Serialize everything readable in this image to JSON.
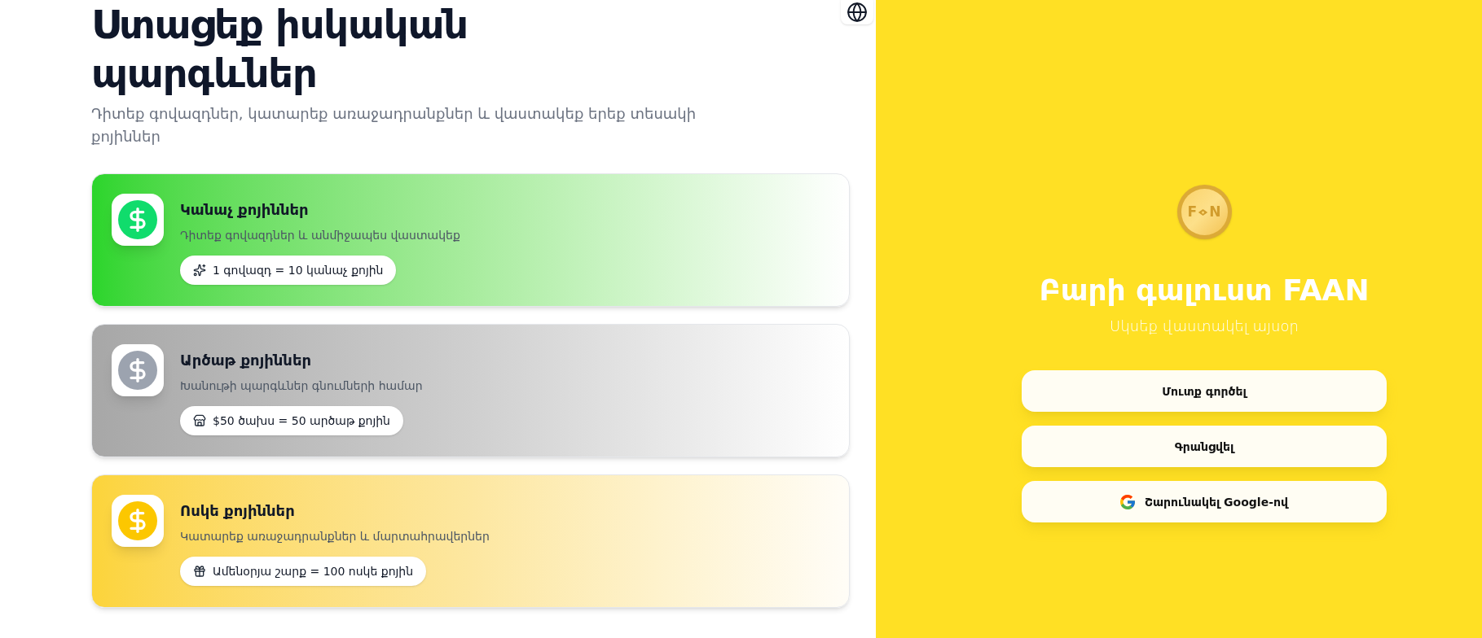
{
  "hero": {
    "title": "Ստացեք իսկական պարգևներ",
    "subtitle": "Դիտեք գովազդներ, կատարեք առաջադրանքներ և վաստակեք երեք տեսակի քոյիններ"
  },
  "cards": [
    {
      "kind": "green",
      "color": "#10dc6c",
      "title": "Կանաչ քոյիններ",
      "description": "Դիտեք գովազդներ և անմիջապես վաստակեք",
      "reward": "1 գովազդ = 10 կանաչ քոյին"
    },
    {
      "kind": "silver",
      "color": "#9ca3af",
      "title": "Արծաթ քոյիններ",
      "description": "Խանութի պարգևներ գնումների համար",
      "reward": "$50 ծախս = 50 արծաթ քոյին"
    },
    {
      "kind": "gold",
      "color": "#fcc700",
      "title": "Ոսկե քոյիններ",
      "description": "Կատարեք առաջադրանքներ և մարտահրավերներ",
      "reward": "Ամենօրյա շարք = 100 ոսկե քոյին"
    }
  ],
  "auth": {
    "logo": {
      "letters": [
        "F",
        "N"
      ]
    },
    "title": "Բարի գալուստ FAAN",
    "subtitle": "Սկսեք վաստակել այսօր",
    "buttons": [
      {
        "kind": "plain",
        "label": "Մուտք գործել"
      },
      {
        "kind": "plain",
        "label": "Գրանցվել"
      },
      {
        "kind": "google",
        "label": "Շարունակել Google-ով"
      }
    ]
  }
}
